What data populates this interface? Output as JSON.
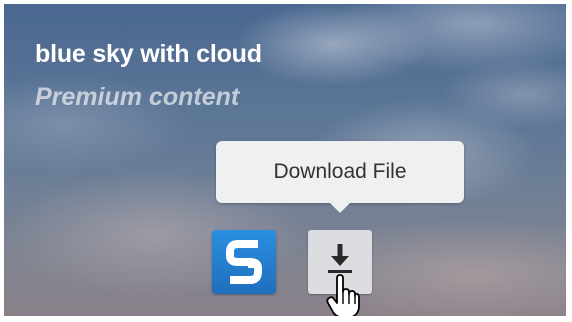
{
  "card": {
    "title": "blue sky with cloud",
    "subtitle": "Premium content"
  },
  "tooltip": {
    "text": "Download File"
  },
  "buttons": {
    "brand_icon": "shutterstock-s-logo",
    "download_icon": "download-icon"
  },
  "colors": {
    "brand_blue": "#2080d0",
    "tooltip_bg": "#eef0f2",
    "download_bg": "#dcdde0"
  }
}
